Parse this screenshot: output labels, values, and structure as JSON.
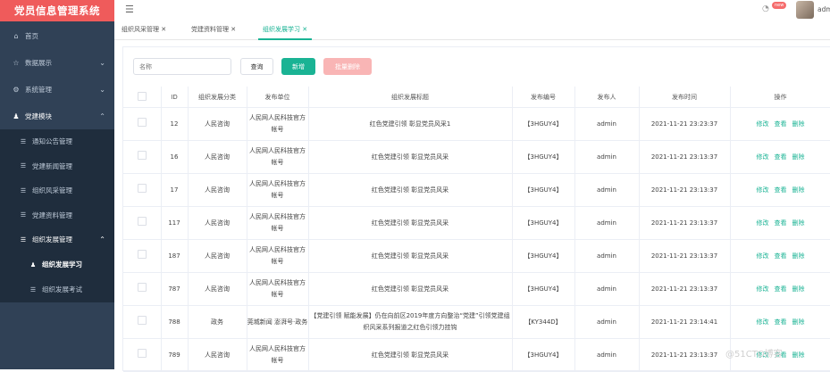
{
  "app": {
    "title": "党员信息管理系统"
  },
  "sidebar": {
    "items": [
      {
        "label": "首页",
        "icon": "home-icon"
      },
      {
        "label": "数据展示",
        "icon": "star-icon"
      },
      {
        "label": "系统管理",
        "icon": "gear-icon"
      },
      {
        "label": "党建模块",
        "icon": "user-icon"
      }
    ],
    "subitems": [
      {
        "label": "通知公告管理"
      },
      {
        "label": "党建新闻管理"
      },
      {
        "label": "组织风采管理"
      },
      {
        "label": "党建资料管理"
      },
      {
        "label": "组织发展管理"
      }
    ],
    "sub2items": [
      {
        "label": "组织发展学习"
      },
      {
        "label": "组织发展考试"
      }
    ]
  },
  "header": {
    "new_badge": "new",
    "username": "admin"
  },
  "tabs": [
    {
      "label": "组织风采管理"
    },
    {
      "label": "党建资料管理"
    },
    {
      "label": "组织发展学习"
    }
  ],
  "toolbar": {
    "search_placeholder": "名称",
    "query_label": "查询",
    "add_label": "新增",
    "batch_delete_label": "批量删除"
  },
  "table": {
    "headers": [
      "ID",
      "组织发展分类",
      "发布单位",
      "组织发展标题",
      "发布编号",
      "发布人",
      "发布时间",
      "操作"
    ],
    "op_labels": {
      "edit": "修改",
      "view": "查看",
      "delete": "删除"
    },
    "rows": [
      {
        "id": "12",
        "category": "人民咨询",
        "unit": "人民网人民科技官方帐号",
        "title": "红色党建引领 彰显党员风采1",
        "code": "【3HGUY4】",
        "publisher": "admin",
        "time": "2021-11-21 23:23:37"
      },
      {
        "id": "16",
        "category": "人民咨询",
        "unit": "人民网人民科技官方帐号",
        "title": "红色党建引领 彰显党员风采",
        "code": "【3HGUY4】",
        "publisher": "admin",
        "time": "2021-11-21 23:13:37"
      },
      {
        "id": "17",
        "category": "人民咨询",
        "unit": "人民网人民科技官方帐号",
        "title": "红色党建引领 彰显党员风采",
        "code": "【3HGUY4】",
        "publisher": "admin",
        "time": "2021-11-21 23:13:37"
      },
      {
        "id": "117",
        "category": "人民咨询",
        "unit": "人民网人民科技官方帐号",
        "title": "红色党建引领 彰显党员风采",
        "code": "【3HGUY4】",
        "publisher": "admin",
        "time": "2021-11-21 23:13:37"
      },
      {
        "id": "187",
        "category": "人民咨询",
        "unit": "人民网人民科技官方帐号",
        "title": "红色党建引领 彰显党员风采",
        "code": "【3HGUY4】",
        "publisher": "admin",
        "time": "2021-11-21 23:13:37"
      },
      {
        "id": "787",
        "category": "人民咨询",
        "unit": "人民网人民科技官方帐号",
        "title": "红色党建引领 彰显党员风采",
        "code": "【3HGUY4】",
        "publisher": "admin",
        "time": "2021-11-21 23:13:37"
      },
      {
        "id": "788",
        "category": "政务",
        "unit": "莞城新闻 澎湃号·政务",
        "title": "【党建引领 赋能发展】仍在向前区2019年度方向整治“党建”引领党建组织风采系列报道之红色引领力挂钩",
        "code": "【KY344D】",
        "publisher": "admin",
        "time": "2021-11-21 23:14:41"
      },
      {
        "id": "789",
        "category": "人民咨询",
        "unit": "人民网人民科技官方帐号",
        "title": "红色党建引领 彰显党员风采",
        "code": "【3HGUY4】",
        "publisher": "admin",
        "time": "2021-11-21 23:13:37"
      }
    ]
  },
  "watermark": "@51CTO博客",
  "colors": {
    "sidebar_bg": "#304156",
    "brand_bg": "#ef5b5b",
    "accent": "#1ab394",
    "danger_light": "#f9b5b5"
  }
}
